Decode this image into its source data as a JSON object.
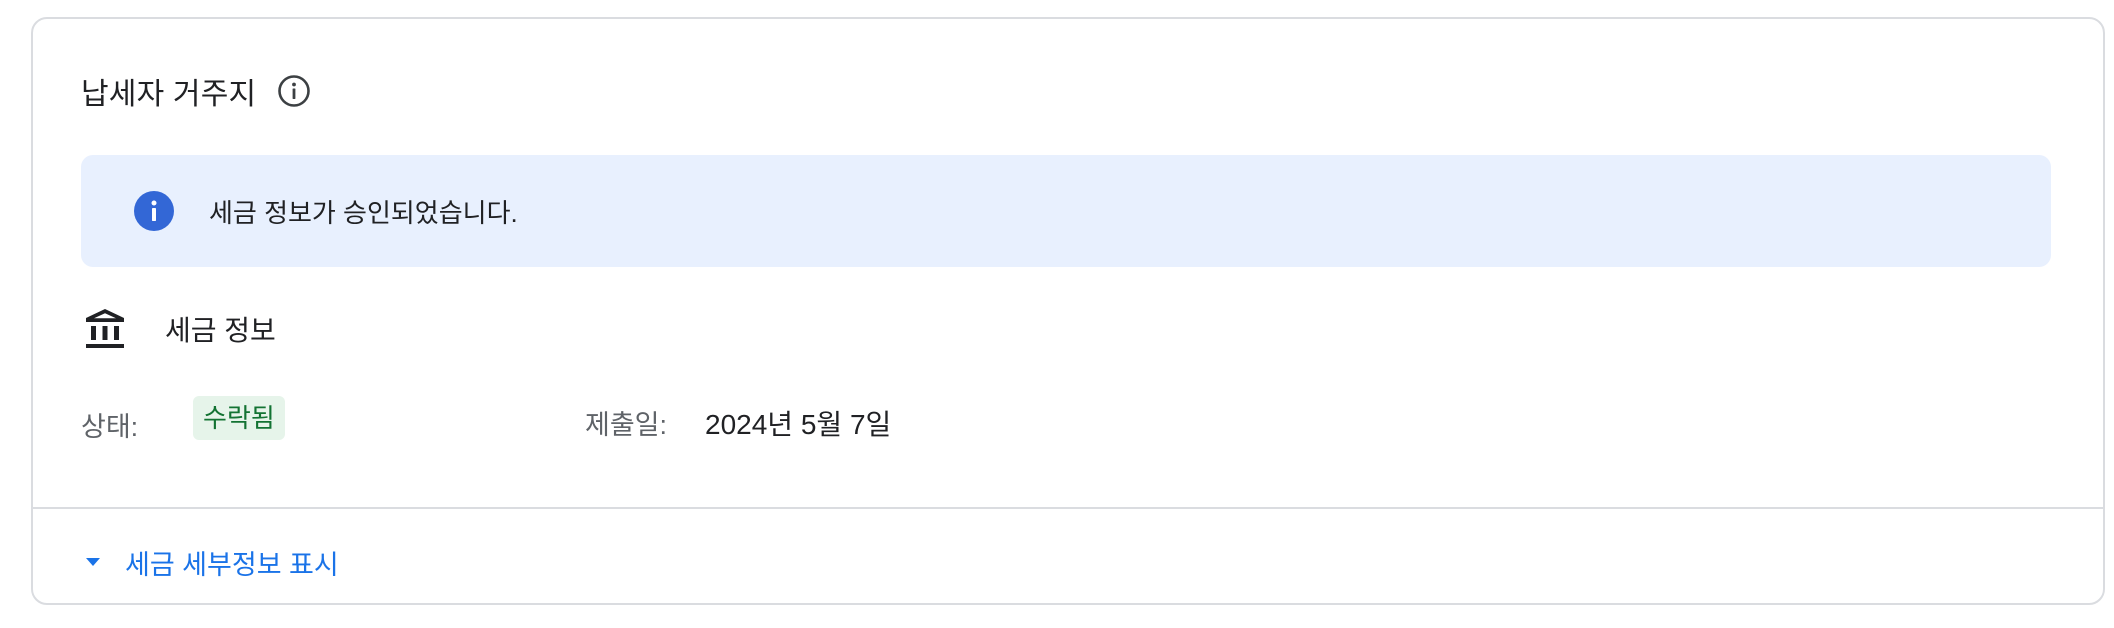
{
  "card": {
    "title": "납세자 거주지",
    "title_info_icon": "info-outline-icon"
  },
  "banner": {
    "icon": "info-filled-icon",
    "message": "세금 정보가 승인되었습니다.",
    "background_color": "#e8f0fe",
    "icon_color": "#3367d6"
  },
  "tax_section": {
    "icon": "bank-icon",
    "title": "세금 정보",
    "status_label": "상태:",
    "status_value": "수락됨",
    "status_badge_bg": "#e6f4ea",
    "status_badge_color": "#137333",
    "submitted_label": "제출일:",
    "submitted_value": "2024년 5월 7일"
  },
  "details_toggle": {
    "icon": "caret-down-icon",
    "label": "세금 세부정보 표시",
    "color": "#1a73e8"
  }
}
